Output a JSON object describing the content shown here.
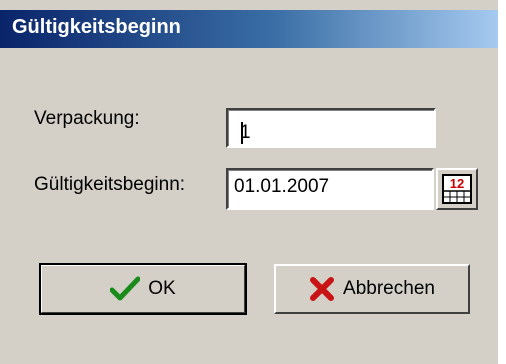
{
  "window": {
    "title": "Gültigkeitsbeginn"
  },
  "form": {
    "verpackung": {
      "label": "Verpackung:",
      "value": "1"
    },
    "gueltigkeitsbeginn": {
      "label": "Gültigkeitsbeginn:",
      "value": "01.01.2007",
      "calendar_icon_text": "12"
    }
  },
  "buttons": {
    "ok": {
      "label": "OK",
      "icon": "checkmark-icon",
      "color": "#1a8a1a"
    },
    "cancel": {
      "label": "Abbrechen",
      "icon": "x-icon",
      "color": "#c81414"
    }
  }
}
